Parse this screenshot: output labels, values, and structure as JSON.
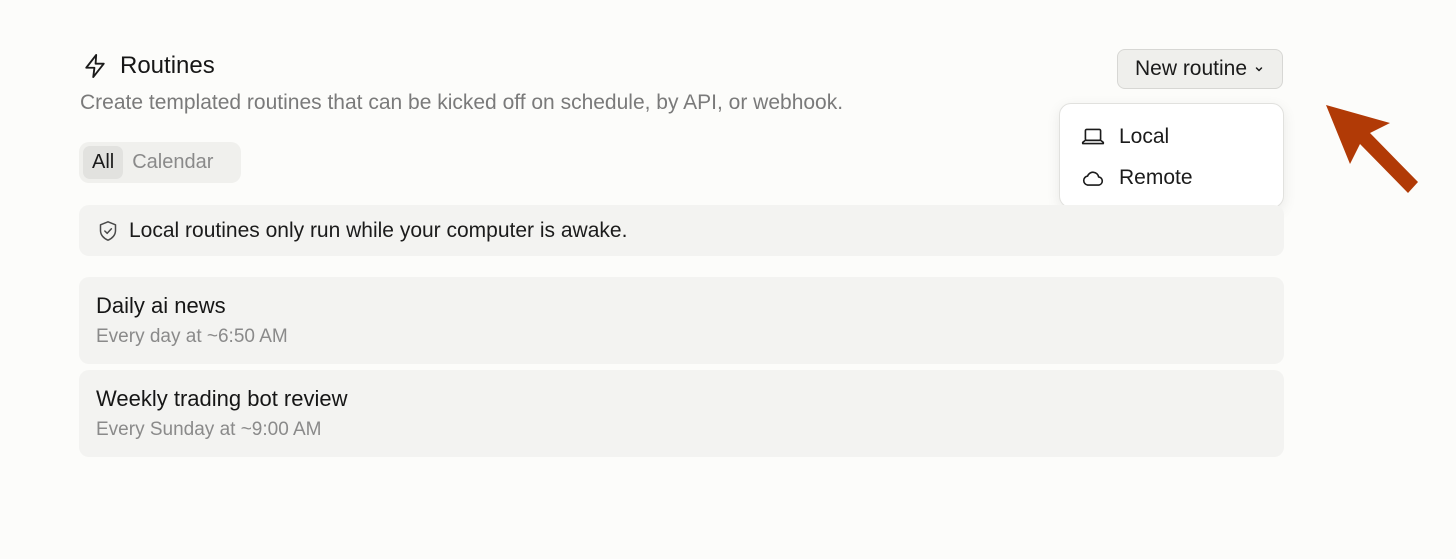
{
  "header": {
    "title": "Routines",
    "title_icon": "lightning-bolt-icon",
    "subtitle": "Create templated routines that can be kicked off on schedule, by API, or webhook."
  },
  "new_routine_button": {
    "label": "New routine",
    "icon": "chevron-down-icon"
  },
  "dropdown": {
    "items": [
      {
        "label": "Local",
        "icon": "laptop-icon"
      },
      {
        "label": "Remote",
        "icon": "cloud-icon"
      }
    ]
  },
  "tabs": [
    {
      "label": "All",
      "active": true
    },
    {
      "label": "Calendar",
      "active": false
    }
  ],
  "notice": {
    "text": "Local routines only run while your computer is awake.",
    "icon": "shield-check-icon"
  },
  "routines": [
    {
      "name": "Daily ai news",
      "schedule": "Every day at ~6:50 AM"
    },
    {
      "name": "Weekly trading bot review",
      "schedule": "Every Sunday at ~9:00 AM"
    }
  ],
  "colors": {
    "background": "#fcfcfa",
    "card": "#f3f3f1",
    "annotation_arrow": "#b13a06"
  }
}
